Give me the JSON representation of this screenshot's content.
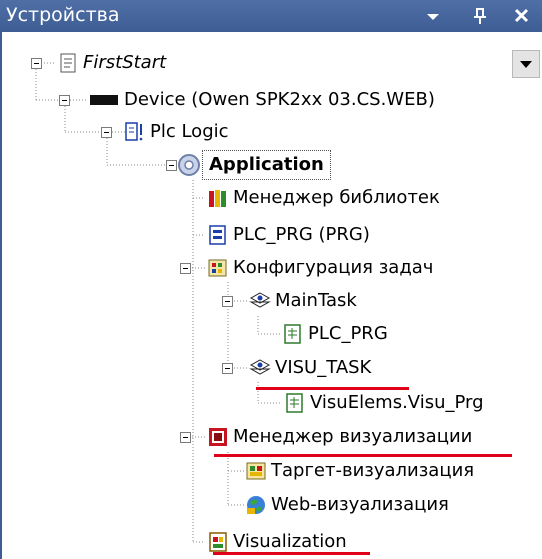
{
  "panel": {
    "title": "Устройства"
  },
  "tree": {
    "firststart": "FirstStart",
    "device": "Device (Owen SPK2xx 03.CS.WEB)",
    "plc_logic": "Plc Logic",
    "application": "Application",
    "library_manager": "Менеджер библиотек",
    "plc_prg": "PLC_PRG (PRG)",
    "task_config": "Конфигурация задач",
    "main_task": "MainTask",
    "main_task_call": "PLC_PRG",
    "visu_task": "VISU_TASK",
    "visu_task_call": "VisuElems.Visu_Prg",
    "visu_manager": "Менеджер визуализации",
    "target_visu": "Таргет-визуализация",
    "web_visu": "Web-визуализация",
    "visualization": "Visualization"
  }
}
